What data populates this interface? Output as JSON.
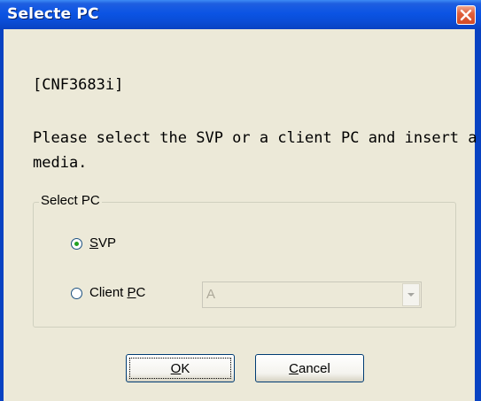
{
  "window": {
    "title": "Selecte PC"
  },
  "content": {
    "id_text": "[CNF3683i]",
    "message_line1": "Please select the SVP or a client PC and insert a",
    "message_line2": "media."
  },
  "group": {
    "legend": "Select PC",
    "options": [
      {
        "label_first": "S",
        "label_rest": "VP",
        "checked": true
      },
      {
        "label_prefix": "Client ",
        "label_underline": "P",
        "label_rest": "C",
        "checked": false
      }
    ],
    "combo_value": "A"
  },
  "buttons": {
    "ok_underline": "O",
    "ok_rest": "K",
    "cancel_underline": "C",
    "cancel_rest": "ancel"
  },
  "colors": {
    "title_bar": "#0b54e4",
    "dialog_face": "#ece9d8",
    "close_button": "#e0603c"
  },
  "icons": {
    "close": "close-icon",
    "dropdown": "chevron-down-icon"
  }
}
